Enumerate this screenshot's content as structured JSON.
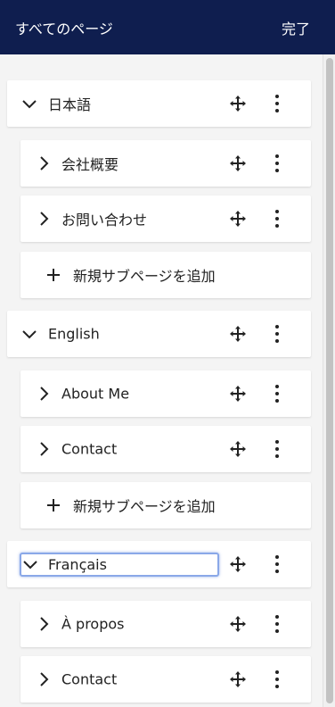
{
  "header": {
    "title": "すべてのページ",
    "done_label": "完了"
  },
  "languages": [
    {
      "name": "日本語",
      "subpages": [
        "会社概要",
        "お問い合わせ"
      ],
      "add_label": "新規サブページを追加"
    },
    {
      "name": "English",
      "subpages": [
        "About Me",
        "Contact"
      ],
      "add_label": "新規サブページを追加"
    },
    {
      "name": "Français",
      "subpages": [
        "À propos",
        "Contact"
      ]
    }
  ],
  "icons": {
    "expand": "chevron-down-icon",
    "collapse": "chevron-right-icon",
    "move": "move-icon",
    "menu": "kebab-menu-icon",
    "add": "plus-icon"
  },
  "colors": {
    "header_bg": "#0f1e4f",
    "focus_ring": "#8aa8e8"
  }
}
